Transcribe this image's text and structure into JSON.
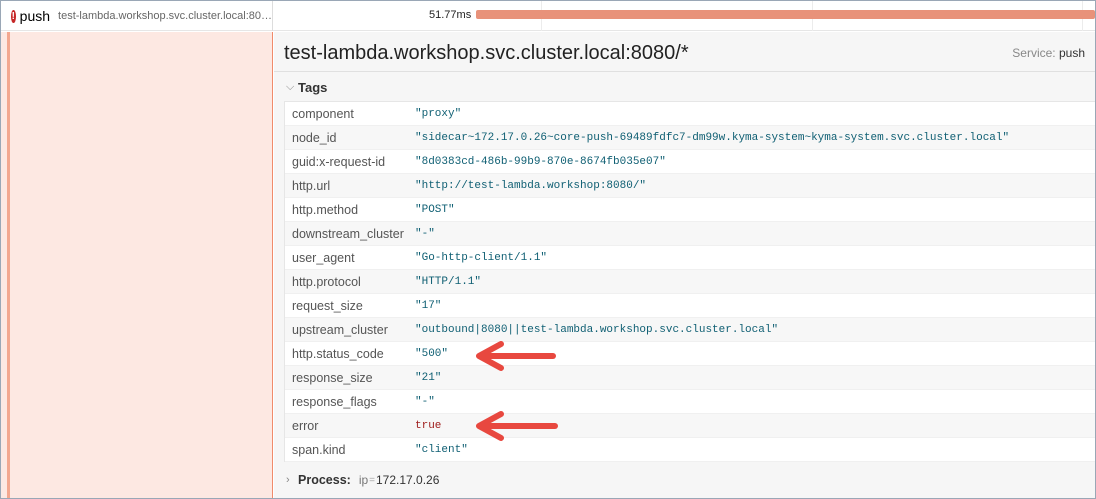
{
  "span": {
    "service": "push",
    "operation": "test-lambda.workshop.svc.cluster.local:80…",
    "duration": "51.77ms",
    "error_icon": "exclamation-circle-icon"
  },
  "detail": {
    "title": "test-lambda.workshop.svc.cluster.local:8080/*",
    "service_label": "Service:",
    "service_value": "push",
    "tags_label": "Tags",
    "tags": [
      {
        "key": "component",
        "value": "\"proxy\""
      },
      {
        "key": "node_id",
        "value": "\"sidecar~172.17.0.26~core-push-69489fdfc7-dm99w.kyma-system~kyma-system.svc.cluster.local\""
      },
      {
        "key": "guid:x-request-id",
        "value": "\"8d0383cd-486b-99b9-870e-8674fb035e07\""
      },
      {
        "key": "http.url",
        "value": "\"http://test-lambda.workshop:8080/\""
      },
      {
        "key": "http.method",
        "value": "\"POST\""
      },
      {
        "key": "downstream_cluster",
        "value": "\"-\""
      },
      {
        "key": "user_agent",
        "value": "\"Go-http-client/1.1\""
      },
      {
        "key": "http.protocol",
        "value": "\"HTTP/1.1\""
      },
      {
        "key": "request_size",
        "value": "\"17\""
      },
      {
        "key": "upstream_cluster",
        "value": "\"outbound|8080||test-lambda.workshop.svc.cluster.local\""
      },
      {
        "key": "http.status_code",
        "value": "\"500\""
      },
      {
        "key": "response_size",
        "value": "\"21\""
      },
      {
        "key": "response_flags",
        "value": "\"-\""
      },
      {
        "key": "error",
        "value": "true"
      },
      {
        "key": "span.kind",
        "value": "\"client\""
      }
    ],
    "process": {
      "label": "Process:",
      "key": "ip",
      "value": "172.17.0.26"
    }
  },
  "colors": {
    "span_bar": "#e8927a",
    "left_strip": "#fde8e2",
    "annotation_arrow": "#e8483f",
    "tag_value": "#0f5f73",
    "error_value": "#a0201f"
  }
}
